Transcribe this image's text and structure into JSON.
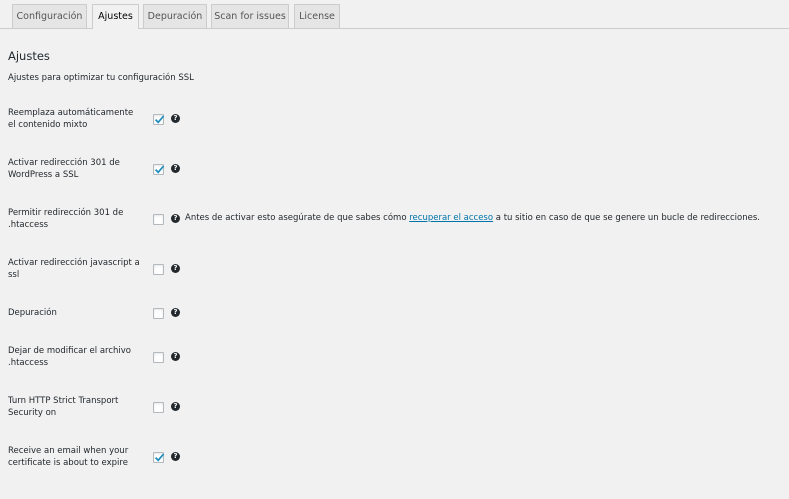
{
  "tabs": [
    {
      "label": "Configuración",
      "active": false
    },
    {
      "label": "Ajustes",
      "active": true
    },
    {
      "label": "Depuración",
      "active": false
    },
    {
      "label": "Scan for issues",
      "active": false
    },
    {
      "label": "License",
      "active": false
    }
  ],
  "section": {
    "title": "Ajustes",
    "description": "Ajustes para optimizar tu configuración SSL"
  },
  "settings": [
    {
      "line1": "Reemplaza automáticamente",
      "line2": "el contenido mixto",
      "checked": true
    },
    {
      "line1": "Activar redirección 301 de",
      "line2": "WordPress a SSL",
      "checked": true
    },
    {
      "line1": "Permitir redirección 301 de",
      "line2": ".htaccess",
      "checked": false,
      "note": {
        "before": "Antes de activar esto asegúrate de que sabes cómo ",
        "link": "recuperar el acceso",
        "after": " a tu sitio en caso de que se genere un bucle de redirecciones."
      }
    },
    {
      "line1": "Activar redirección javascript a",
      "line2": "ssl",
      "checked": false
    },
    {
      "line1": "Depuración",
      "line2": "",
      "checked": false
    },
    {
      "line1": "Dejar de modificar el archivo",
      "line2": ".htaccess",
      "checked": false
    },
    {
      "line1": "Turn HTTP Strict Transport",
      "line2": "Security on",
      "checked": false
    },
    {
      "line1": "Receive an email when your",
      "line2": "certificate is about to expire",
      "checked": true
    }
  ],
  "help_glyph": "?",
  "icons": {
    "help": "question-circle-icon",
    "check": "checkmark-icon"
  },
  "colors": {
    "background": "#f1f1f1",
    "check": "#1e8cbe",
    "link": "#0073aa",
    "text": "#23282d"
  }
}
